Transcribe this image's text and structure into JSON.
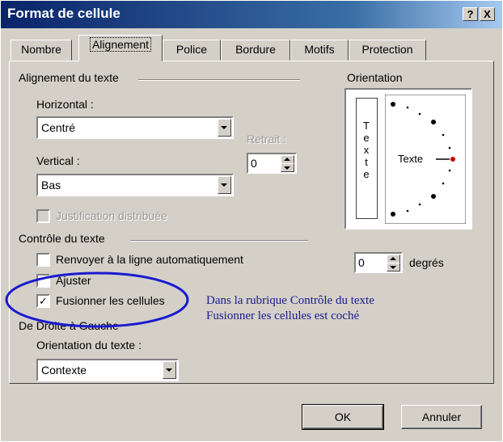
{
  "window": {
    "title": "Format de cellule",
    "help_btn": "?",
    "close_btn": "X"
  },
  "tabs": [
    {
      "label": "Nombre"
    },
    {
      "label": "Alignement"
    },
    {
      "label": "Police"
    },
    {
      "label": "Bordure"
    },
    {
      "label": "Motifs"
    },
    {
      "label": "Protection"
    }
  ],
  "alignment": {
    "group_label": "Alignement du texte",
    "horizontal_label": "Horizontal :",
    "horizontal_value": "Centré",
    "vertical_label": "Vertical :",
    "vertical_value": "Bas",
    "indent_label": "Retrait :",
    "indent_value": "0",
    "distributed_label": "Justification distribuée"
  },
  "orientation": {
    "group_label": "Orientation",
    "vertical_text": "Texte",
    "dial_text": "Texte",
    "degrees_value": "0",
    "degrees_label": "degrés"
  },
  "text_control": {
    "group_label": "Contrôle du texte",
    "wrap_label": "Renvoyer à la ligne automatiquement",
    "shrink_label": "Ajuster",
    "merge_label": "Fusionner les cellules",
    "wrap_checked": false,
    "shrink_checked": false,
    "merge_checked": true,
    "check_glyph": "✓"
  },
  "rtl": {
    "group_label": "De Droite à Gauche",
    "direction_label": "Orientation du texte :",
    "direction_value": "Contexte"
  },
  "annotation": {
    "line1": "Dans la rubrique Contrôle du texte",
    "line2": "Fusionner les cellules est coché",
    "color": "#1a1a8c"
  },
  "buttons": {
    "ok": "OK",
    "cancel": "Annuler"
  }
}
